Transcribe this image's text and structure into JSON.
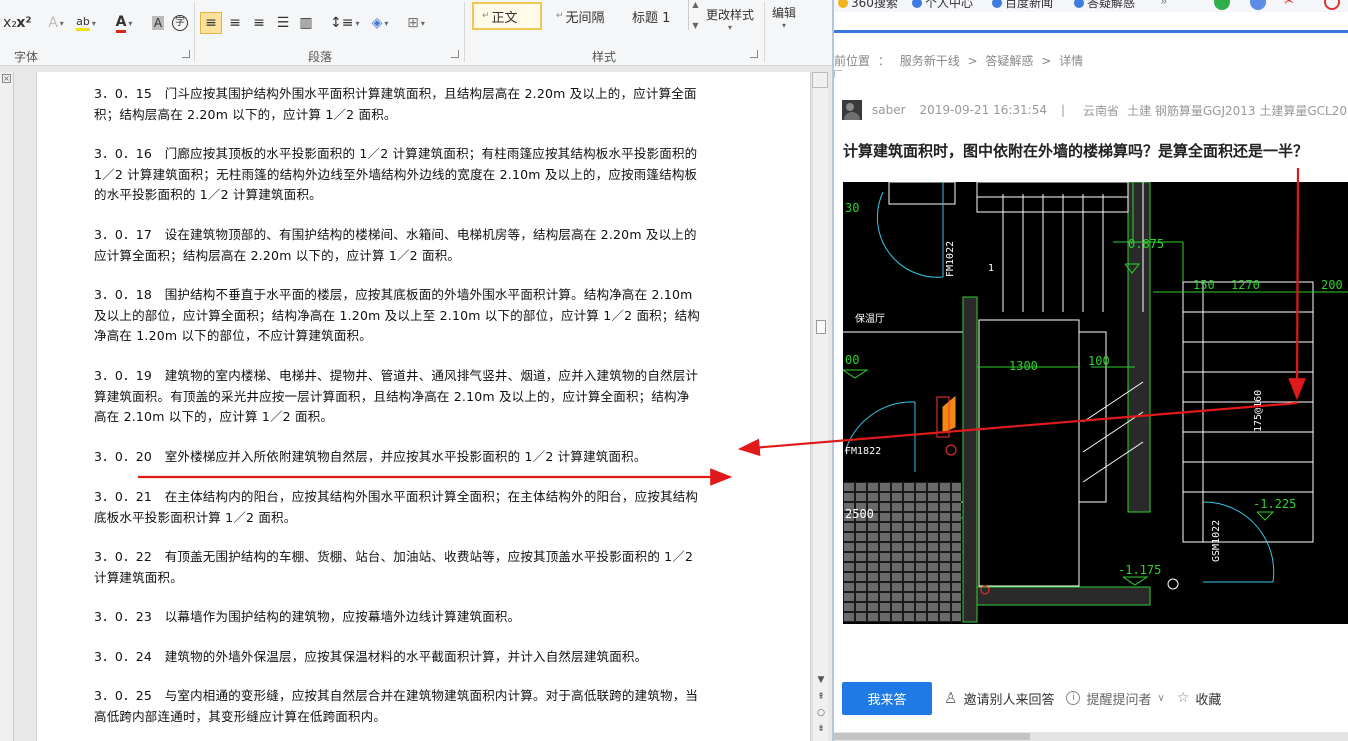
{
  "word": {
    "ribbon": {
      "font_group_label": "字体",
      "paragraph_group_label": "段落",
      "styles_group_label": "样式",
      "superscript_label": "x²",
      "subscript_label": "x₂",
      "styles": [
        "正文",
        "无间隔",
        "标题 1"
      ],
      "change_styles_label": "更改样式",
      "editing_label": "编辑"
    },
    "paragraphs": [
      "3．0．15　门斗应按其围护结构外围水平面积计算建筑面积，且结构层高在 2.20m 及以上的，应计算全面积；结构层高在 2.20m 以下的，应计算 1／2 面积。",
      "3．0．16　门廊应按其顶板的水平投影面积的 1／2 计算建筑面积；有柱雨篷应按其结构板水平投影面积的 1／2 计算建筑面积；无柱雨篷的结构外边线至外墙结构外边线的宽度在 2.10m 及以上的，应按雨篷结构板的水平投影面积的 1／2 计算建筑面积。",
      "3．0．17　设在建筑物顶部的、有围护结构的楼梯间、水箱间、电梯机房等，结构层高在 2.20m 及以上的应计算全面积；结构层高在 2.20m 以下的，应计算 1／2 面积。",
      "3．0．18　围护结构不垂直于水平面的楼层，应按其底板面的外墙外围水平面积计算。结构净高在 2.10m 及以上的部位，应计算全面积；结构净高在 1.20m 及以上至 2.10m 以下的部位，应计算 1／2 面积；结构净高在 1.20m 以下的部位，不应计算建筑面积。",
      "3．0．19　建筑物的室内楼梯、电梯井、提物井、管道井、通风排气竖井、烟道，应并入建筑物的自然层计算建筑面积。有顶盖的采光井应按一层计算面积，且结构净高在 2.10m 及以上的，应计算全面积；结构净高在 2.10m 以下的，应计算 1／2 面积。",
      "3．0．20　室外楼梯应并入所依附建筑物自然层，并应按其水平投影面积的 1／2 计算建筑面积。",
      "3．0．21　在主体结构内的阳台，应按其结构外围水平面积计算全面积；在主体结构外的阳台，应按其结构底板水平投影面积计算 1／2 面积。",
      "3．0．22　有顶盖无围护结构的车棚、货棚、站台、加油站、收费站等，应按其顶盖水平投影面积的 1／2 计算建筑面积。",
      "3．0．23　以幕墙作为围护结构的建筑物，应按幕墙外边线计算建筑面积。",
      "3．0．24　建筑物的外墙外保温层，应按其保温材料的水平截面积计算，并计入自然层建筑面积。",
      "3．0．25　与室内相通的变形缝，应按其自然层合并在建筑物建筑面积内计算。对于高低联跨的建筑物，当高低跨内部连通时，其变形缝应计算在低跨面积内。"
    ]
  },
  "browser": {
    "bookmarks": [
      "360搜索",
      "个人中心",
      "百度新闻",
      "答疑解惑",
      "»"
    ],
    "breadcrumb": {
      "prefix": "前位置",
      "items": [
        "服务新干线",
        "答疑解惑",
        "详情"
      ],
      "separator": ">"
    },
    "post": {
      "author": "saber",
      "datetime": "2019-09-21 16:31:54",
      "divider": "|",
      "region": "云南省",
      "tags": "土建 钢筋算量GGJ2013 土建算量GCL2013",
      "title": "计算建筑面积时，图中依附在外墙的楼梯算吗？是算全面积还是一半？"
    },
    "cad": {
      "dims": [
        "0.875",
        "150",
        "1270",
        "200",
        "1300",
        "100",
        "2500",
        "-1.225",
        "-1.175",
        "00",
        "30"
      ],
      "labels": [
        "FM1022",
        "保温厅",
        "FM1822",
        "GSM1022",
        "175@160",
        "1"
      ]
    },
    "actions": {
      "answer_label": "我来答",
      "invite_label": "邀请别人来回答",
      "remind_label": "提醒提问者",
      "favorite_label": "收藏"
    }
  },
  "colors": {
    "accent_blue": "#1f7ae6",
    "annotation_red": "#e01a1a",
    "cad_green": "#2fd12f",
    "cad_yellow": "#d6d61a",
    "cad_cyan": "#39c7e6"
  }
}
